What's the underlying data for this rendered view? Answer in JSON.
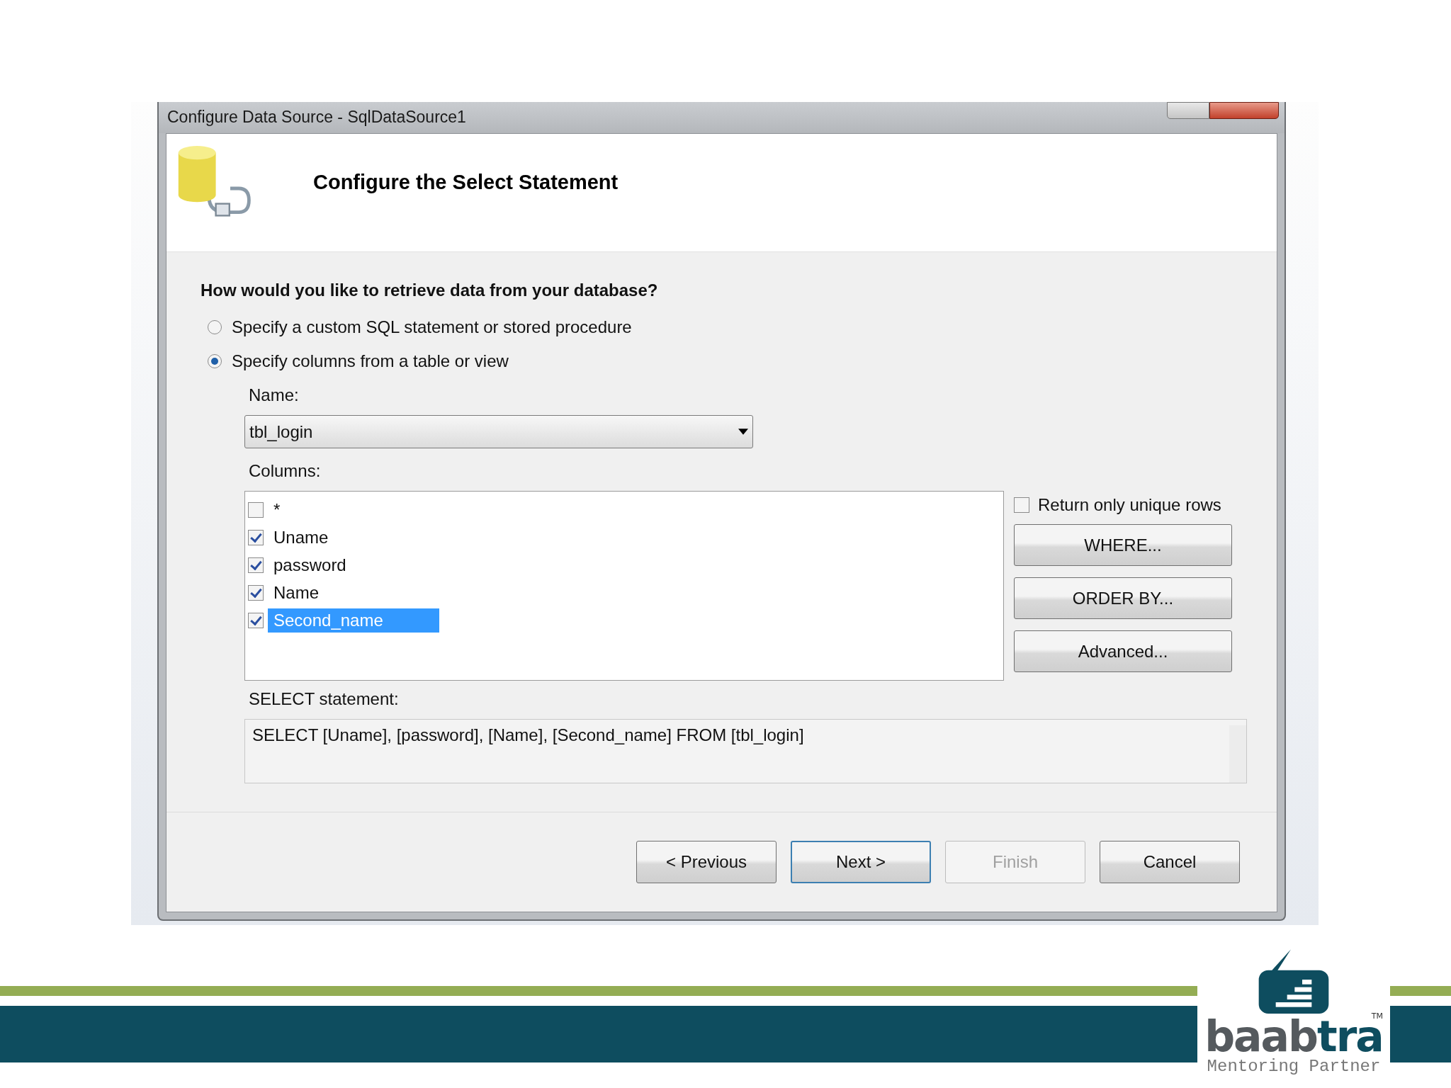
{
  "dialog": {
    "title": "Configure Data Source - SqlDataSource1",
    "heading": "Configure the Select Statement"
  },
  "question": "How would you like to retrieve data from your database?",
  "options": [
    {
      "label": "Specify a custom SQL statement or stored procedure",
      "selected": false
    },
    {
      "label": "Specify columns from a table or view",
      "selected": true
    }
  ],
  "name_label": "Name:",
  "name_value": "tbl_login",
  "columns_label": "Columns:",
  "columns": [
    {
      "label": "*",
      "checked": false,
      "selected": false
    },
    {
      "label": "Uname",
      "checked": true,
      "selected": false
    },
    {
      "label": "password",
      "checked": true,
      "selected": false
    },
    {
      "label": "Name",
      "checked": true,
      "selected": false
    },
    {
      "label": "Second_name",
      "checked": true,
      "selected": true
    }
  ],
  "unique_rows": {
    "label": "Return only unique rows",
    "checked": false
  },
  "side_buttons": [
    "WHERE...",
    "ORDER BY...",
    "Advanced..."
  ],
  "statement_label": "SELECT statement:",
  "statement": "SELECT [Uname], [password], [Name], [Second_name] FROM [tbl_login]",
  "nav_buttons": [
    {
      "label": "< Previous",
      "disabled": false,
      "selected": false
    },
    {
      "label": "Next >",
      "disabled": false,
      "selected": true
    },
    {
      "label": "Finish",
      "disabled": true,
      "selected": false
    },
    {
      "label": "Cancel",
      "disabled": false,
      "selected": false
    }
  ],
  "logo": {
    "wordmark_head": "baab",
    "wordmark_tail": "tra",
    "trademark": "TM",
    "tagline": "Mentoring Partner"
  }
}
